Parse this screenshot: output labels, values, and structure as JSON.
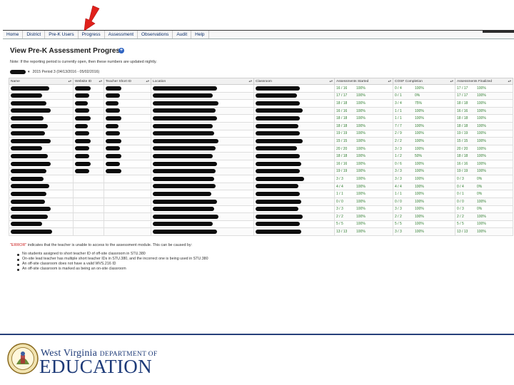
{
  "nav": {
    "items": [
      "Home",
      "District",
      "Pre-K Users",
      "Progress",
      "Assessment",
      "Observations",
      "Audit",
      "Help"
    ]
  },
  "page": {
    "title": "View Pre-K Assessment Progress",
    "note": "Note: If the reporting period is currently open, then these numbers are updated nightly.",
    "period_select": "2015 Period 3 (04/13/2016 - 05/02/2016)"
  },
  "table": {
    "columns": [
      "Name",
      "Website ID",
      "Teacher Short ID",
      "Location",
      "Classroom",
      "Assessments Started",
      "COSF Completion",
      "Assessments Finalized"
    ],
    "rows": [
      {
        "started": "16 / 16",
        "started_pct": "100%",
        "cosf": "0 / 4",
        "cosf_pct": "100%",
        "cosf_status": "good",
        "final": "17 / 17",
        "final_pct": "100%",
        "final_status": "good"
      },
      {
        "started": "17 / 17",
        "started_pct": "100%",
        "cosf": "0 / 1",
        "cosf_pct": "0%",
        "cosf_status": "bad",
        "final": "17 / 17",
        "final_pct": "100%",
        "final_status": "good"
      },
      {
        "started": "18 / 18",
        "started_pct": "100%",
        "cosf": "3 / 4",
        "cosf_pct": "75%",
        "cosf_status": "warn",
        "final": "18 / 18",
        "final_pct": "100%",
        "final_status": "good"
      },
      {
        "started": "16 / 16",
        "started_pct": "100%",
        "cosf": "1 / 1",
        "cosf_pct": "100%",
        "cosf_status": "good",
        "final": "16 / 16",
        "final_pct": "100%",
        "final_status": "good"
      },
      {
        "started": "18 / 18",
        "started_pct": "100%",
        "cosf": "1 / 1",
        "cosf_pct": "100%",
        "cosf_status": "good",
        "final": "18 / 18",
        "final_pct": "100%",
        "final_status": "good"
      },
      {
        "started": "18 / 18",
        "started_pct": "100%",
        "cosf": "7 / 7",
        "cosf_pct": "100%",
        "cosf_status": "good",
        "final": "18 / 18",
        "final_pct": "100%",
        "final_status": "good"
      },
      {
        "started": "19 / 19",
        "started_pct": "100%",
        "cosf": "2 / 9",
        "cosf_pct": "100%",
        "cosf_status": "good",
        "final": "19 / 19",
        "final_pct": "100%",
        "final_status": "good"
      },
      {
        "started": "15 / 15",
        "started_pct": "100%",
        "cosf": "2 / 2",
        "cosf_pct": "100%",
        "cosf_status": "good",
        "final": "15 / 15",
        "final_pct": "100%",
        "final_status": "good"
      },
      {
        "started": "20 / 20",
        "started_pct": "100%",
        "cosf": "3 / 3",
        "cosf_pct": "100%",
        "cosf_status": "good",
        "final": "20 / 20",
        "final_pct": "100%",
        "final_status": "good"
      },
      {
        "started": "18 / 18",
        "started_pct": "100%",
        "cosf": "1 / 2",
        "cosf_pct": "50%",
        "cosf_status": "warn",
        "final": "18 / 18",
        "final_pct": "100%",
        "final_status": "good"
      },
      {
        "started": "16 / 16",
        "started_pct": "100%",
        "cosf": "0 / 6",
        "cosf_pct": "100%",
        "cosf_status": "good",
        "final": "16 / 16",
        "final_pct": "100%",
        "final_status": "good"
      },
      {
        "started": "19 / 19",
        "started_pct": "100%",
        "cosf": "3 / 3",
        "cosf_pct": "100%",
        "cosf_status": "good",
        "final": "19 / 19",
        "final_pct": "100%",
        "final_status": "good"
      },
      {
        "started": "3 / 3",
        "started_pct": "100%",
        "cosf": "3 / 3",
        "cosf_pct": "100%",
        "cosf_status": "good",
        "final": "0 / 3",
        "final_pct": "0%",
        "final_status": "bad"
      },
      {
        "started": "4 / 4",
        "started_pct": "100%",
        "cosf": "4 / 4",
        "cosf_pct": "100%",
        "cosf_status": "good",
        "final": "0 / 4",
        "final_pct": "0%",
        "final_status": "bad"
      },
      {
        "started": "1 / 1",
        "started_pct": "100%",
        "cosf": "1 / 1",
        "cosf_pct": "100%",
        "cosf_status": "good",
        "final": "0 / 1",
        "final_pct": "0%",
        "final_status": "bad"
      },
      {
        "started": "0 / 0",
        "started_pct": "100%",
        "cosf": "0 / 0",
        "cosf_pct": "100%",
        "cosf_status": "good",
        "final": "0 / 0",
        "final_pct": "100%",
        "final_status": "good"
      },
      {
        "started": "3 / 3",
        "started_pct": "100%",
        "cosf": "3 / 3",
        "cosf_pct": "100%",
        "cosf_status": "good",
        "final": "0 / 3",
        "final_pct": "0%",
        "final_status": "bad"
      },
      {
        "started": "2 / 2",
        "started_pct": "100%",
        "cosf": "2 / 2",
        "cosf_pct": "100%",
        "cosf_status": "good",
        "final": "2 / 2",
        "final_pct": "100%",
        "final_status": "good"
      },
      {
        "started": "5 / 5",
        "started_pct": "100%",
        "cosf": "5 / 5",
        "cosf_pct": "100%",
        "cosf_status": "good",
        "final": "5 / 5",
        "final_pct": "100%",
        "final_status": "good"
      },
      {
        "started": "13 / 13",
        "started_pct": "100%",
        "cosf": "3 / 3",
        "cosf_pct": "100%",
        "cosf_status": "good",
        "final": "13 / 13",
        "final_pct": "100%",
        "final_status": "good"
      }
    ]
  },
  "footnote": {
    "error_word": "\"ERROR\"",
    "text": " indicates that the teacher is unable to access to the assessment module. This can be caused by:",
    "causes": [
      "No students assigned to short teacher ID of off-site classroom in STU.380",
      "On-site lead teacher has multiple short teacher IDs in STU.380, and the incorrect one is being used in STU.380",
      "An off-site classroom does not have a valid WVS.216 ID",
      "An off-site classroom is marked as being an on-site classroom"
    ]
  },
  "footer": {
    "state": "West Virginia",
    "dept": "DEPARTMENT OF",
    "edu": "EDUCATION"
  },
  "colors": {
    "brand_blue": "#1d3a78",
    "good": "#2f8a2f",
    "warn": "#d6891a",
    "bad": "#cc2222",
    "arrow": "#e0201b"
  }
}
